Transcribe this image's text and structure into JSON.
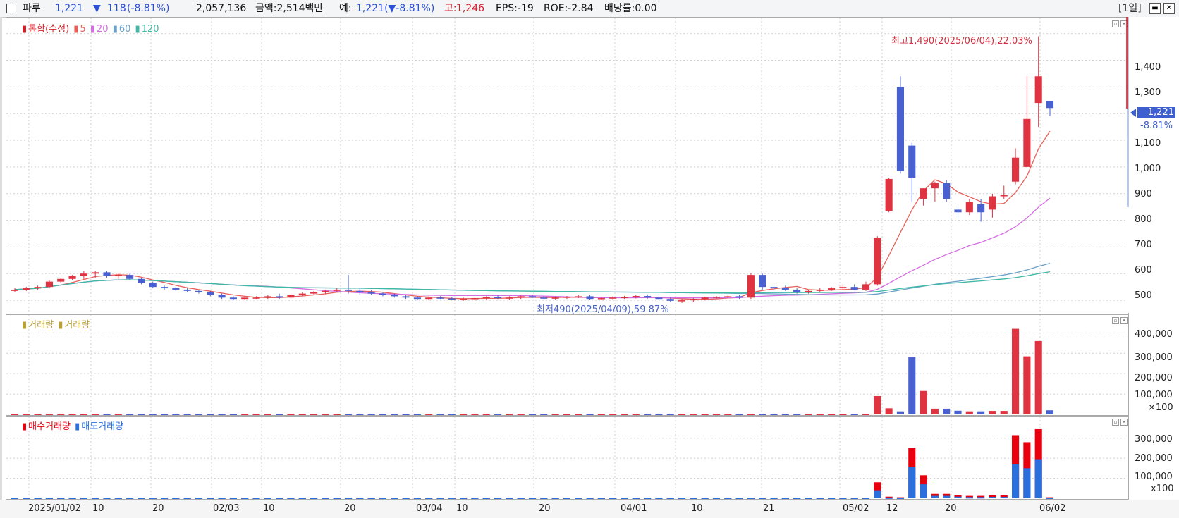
{
  "header": {
    "stock_name": "파루",
    "price": "1,221",
    "change_arrow": "▼",
    "change": "118",
    "change_pct": "(-8.81%)",
    "volume": "2,057,136",
    "amount": "금액:2,514백만",
    "expected_label": "예:",
    "expected_value": "1,221(▼-8.81%)",
    "high_label": "고:",
    "high_value": "1,246",
    "eps": "EPS:-19",
    "roe": "ROE:-2.84",
    "dividend": "배당률:0.00",
    "period": "[1일]",
    "colors": {
      "down": "#2b50d8",
      "up": "#d11f2a"
    }
  },
  "price_panel": {
    "legend": {
      "main": "통합(수정)",
      "ma5": "5",
      "ma20": "20",
      "ma60": "60",
      "ma120": "120"
    },
    "high_annotation": "최고1,490(2025/06/04),22.03%",
    "low_annotation": "최저490(2025/04/09),59.87%",
    "y_labels": [
      "1,400",
      "1,300",
      "1,200",
      "1,100",
      "1,000",
      "900",
      "800",
      "700",
      "600",
      "500"
    ],
    "current_price": "1,221",
    "current_pct": "-8.81%",
    "colors": {
      "up": "#e03341",
      "down": "#4860d0",
      "ma5": "#e8605a",
      "ma20": "#d36de0",
      "ma60": "#6aa0c8",
      "ma120": "#3fb8a5"
    }
  },
  "volume_panel": {
    "legend": [
      "거래량",
      "거래량"
    ],
    "y_labels": [
      "400,000",
      "300,000",
      "200,000",
      "100,000"
    ],
    "unit": "×100"
  },
  "buysell_panel": {
    "legend": {
      "buy": "매수거래량",
      "sell": "매도거래량"
    },
    "y_labels": [
      "300,000",
      "200,000",
      "100,000"
    ],
    "unit": "x100",
    "colors": {
      "buy": "#e8000f",
      "sell": "#2a6fdc"
    }
  },
  "x_axis": {
    "labels": [
      "2025/01/02",
      "10",
      "20",
      "02/03",
      "10",
      "20",
      "03/04",
      "10",
      "20",
      "04/01",
      "10",
      "21",
      "05/02",
      "12",
      "20",
      "06/02"
    ]
  },
  "chart_data": [
    {
      "type": "candlestick",
      "title": "통합(수정)",
      "y_unit": "KRW",
      "ylim": [
        450,
        1560
      ],
      "ma_periods": [
        5,
        20,
        60,
        120
      ],
      "candles_ohlc": [
        [
          535,
          545,
          530,
          540
        ],
        [
          540,
          550,
          535,
          545
        ],
        [
          545,
          555,
          540,
          550
        ],
        [
          550,
          575,
          545,
          570
        ],
        [
          570,
          585,
          565,
          580
        ],
        [
          580,
          595,
          575,
          590
        ],
        [
          590,
          610,
          580,
          600
        ],
        [
          600,
          610,
          585,
          605
        ],
        [
          605,
          610,
          585,
          590
        ],
        [
          590,
          600,
          580,
          595
        ],
        [
          595,
          600,
          575,
          580
        ],
        [
          580,
          585,
          560,
          565
        ],
        [
          565,
          570,
          545,
          550
        ],
        [
          550,
          555,
          540,
          545
        ],
        [
          545,
          550,
          535,
          540
        ],
        [
          540,
          545,
          530,
          535
        ],
        [
          535,
          540,
          525,
          530
        ],
        [
          530,
          535,
          515,
          520
        ],
        [
          520,
          525,
          505,
          510
        ],
        [
          510,
          515,
          500,
          505
        ],
        [
          505,
          515,
          500,
          510
        ],
        [
          510,
          515,
          505,
          510
        ],
        [
          510,
          520,
          505,
          515
        ],
        [
          515,
          525,
          505,
          510
        ],
        [
          510,
          525,
          505,
          520
        ],
        [
          520,
          530,
          515,
          525
        ],
        [
          525,
          535,
          520,
          530
        ],
        [
          530,
          540,
          525,
          535
        ],
        [
          535,
          545,
          530,
          540
        ],
        [
          540,
          595,
          525,
          535
        ],
        [
          535,
          545,
          520,
          530
        ],
        [
          530,
          540,
          520,
          525
        ],
        [
          525,
          530,
          515,
          520
        ],
        [
          520,
          525,
          510,
          515
        ],
        [
          515,
          520,
          505,
          510
        ],
        [
          510,
          515,
          500,
          505
        ],
        [
          505,
          515,
          500,
          510
        ],
        [
          510,
          515,
          505,
          507
        ],
        [
          507,
          512,
          500,
          503
        ],
        [
          503,
          510,
          498,
          505
        ],
        [
          505,
          512,
          500,
          508
        ],
        [
          508,
          515,
          503,
          512
        ],
        [
          512,
          518,
          505,
          508
        ],
        [
          508,
          515,
          502,
          510
        ],
        [
          510,
          517,
          505,
          515
        ],
        [
          515,
          520,
          508,
          510
        ],
        [
          510,
          515,
          505,
          508
        ],
        [
          508,
          513,
          503,
          510
        ],
        [
          510,
          516,
          505,
          513
        ],
        [
          513,
          520,
          508,
          515
        ],
        [
          515,
          520,
          502,
          505
        ],
        [
          505,
          512,
          500,
          508
        ],
        [
          508,
          515,
          503,
          510
        ],
        [
          510,
          516,
          505,
          512
        ],
        [
          512,
          520,
          507,
          516
        ],
        [
          516,
          522,
          505,
          510
        ],
        [
          510,
          515,
          500,
          505
        ],
        [
          505,
          510,
          495,
          498
        ],
        [
          498,
          505,
          490,
          500
        ],
        [
          500,
          508,
          495,
          505
        ],
        [
          505,
          512,
          500,
          510
        ],
        [
          510,
          516,
          505,
          513
        ],
        [
          513,
          518,
          508,
          515
        ],
        [
          515,
          520,
          505,
          510
        ],
        [
          510,
          600,
          505,
          595
        ],
        [
          595,
          600,
          540,
          550
        ],
        [
          550,
          560,
          540,
          545
        ],
        [
          545,
          555,
          535,
          540
        ],
        [
          540,
          545,
          525,
          530
        ],
        [
          530,
          540,
          525,
          535
        ],
        [
          535,
          545,
          530,
          540
        ],
        [
          540,
          550,
          535,
          545
        ],
        [
          545,
          560,
          540,
          550
        ],
        [
          550,
          560,
          538,
          540
        ],
        [
          540,
          570,
          535,
          560
        ],
        [
          560,
          740,
          555,
          735
        ],
        [
          835,
          960,
          830,
          955
        ],
        [
          1300,
          1340,
          975,
          985
        ],
        [
          1080,
          1090,
          870,
          960
        ],
        [
          880,
          920,
          855,
          920
        ],
        [
          920,
          945,
          870,
          940
        ],
        [
          940,
          950,
          870,
          880
        ],
        [
          840,
          850,
          805,
          830
        ],
        [
          830,
          880,
          820,
          870
        ],
        [
          860,
          880,
          795,
          830
        ],
        [
          840,
          900,
          810,
          890
        ],
        [
          890,
          930,
          880,
          895
        ],
        [
          945,
          1070,
          935,
          1035
        ],
        [
          1000,
          1340,
          1000,
          1180
        ],
        [
          1240,
          1490,
          1150,
          1340
        ],
        [
          1246,
          1246,
          1190,
          1221
        ]
      ]
    },
    {
      "type": "bar",
      "title": "거래량",
      "y_unit": "×100",
      "ylim": [
        0,
        460000
      ],
      "values": [
        2000,
        2000,
        2000,
        2000,
        2000,
        2000,
        2000,
        2000,
        2000,
        2000,
        2000,
        2000,
        2000,
        2000,
        2000,
        2000,
        2000,
        2000,
        2000,
        2000,
        2000,
        2000,
        2000,
        2000,
        2000,
        2000,
        2000,
        2000,
        2000,
        2000,
        2000,
        2000,
        2000,
        2000,
        2000,
        2000,
        2000,
        2000,
        2000,
        2000,
        2000,
        2000,
        2000,
        2000,
        2000,
        2000,
        2000,
        2000,
        2000,
        2000,
        2000,
        2000,
        2000,
        2000,
        2000,
        2000,
        2000,
        2000,
        2000,
        2000,
        2000,
        2000,
        2000,
        2000,
        2000,
        2000,
        2000,
        2000,
        2000,
        2000,
        2000,
        2000,
        2000,
        2000,
        2000,
        90000,
        30000,
        15000,
        280000,
        115000,
        28000,
        28000,
        18000,
        15000,
        15000,
        17000,
        17000,
        420000,
        285000,
        360000,
        20000
      ]
    },
    {
      "type": "stacked_bar",
      "title": "매수거래량 / 매도거래량",
      "y_unit": "x100",
      "ylim": [
        0,
        380000
      ],
      "series": [
        {
          "name": "매수거래량",
          "values": [
            3000,
            3000,
            3000,
            3000,
            3000,
            3000,
            3000,
            3000,
            3000,
            3000,
            3000,
            3000,
            3000,
            3000,
            3000,
            3000,
            3000,
            3000,
            3000,
            3000,
            3000,
            3000,
            3000,
            3000,
            3000,
            3000,
            3000,
            3000,
            3000,
            3000,
            3000,
            3000,
            3000,
            3000,
            3000,
            3000,
            3000,
            3000,
            3000,
            3000,
            3000,
            3000,
            3000,
            3000,
            3000,
            3000,
            3000,
            3000,
            3000,
            3000,
            3000,
            3000,
            3000,
            3000,
            3000,
            3000,
            3000,
            3000,
            3000,
            3000,
            3000,
            3000,
            3000,
            3000,
            3000,
            3000,
            3000,
            3000,
            3000,
            3000,
            3000,
            3000,
            3000,
            3000,
            3000,
            80000,
            8000,
            5000,
            250000,
            115000,
            22000,
            22000,
            15000,
            12000,
            12000,
            15000,
            15000,
            315000,
            280000,
            345000,
            5000
          ]
        },
        {
          "name": "매도거래량",
          "values": [
            2000,
            2000,
            2000,
            2000,
            2000,
            2000,
            2000,
            2000,
            2000,
            2000,
            2000,
            2000,
            2000,
            2000,
            2000,
            2000,
            2000,
            2000,
            2000,
            2000,
            2000,
            2000,
            2000,
            2000,
            2000,
            2000,
            2000,
            2000,
            2000,
            2000,
            2000,
            2000,
            2000,
            2000,
            2000,
            2000,
            2000,
            2000,
            2000,
            2000,
            2000,
            2000,
            2000,
            2000,
            2000,
            2000,
            2000,
            2000,
            2000,
            2000,
            2000,
            2000,
            2000,
            2000,
            2000,
            2000,
            2000,
            2000,
            2000,
            2000,
            2000,
            2000,
            2000,
            2000,
            2000,
            2000,
            2000,
            2000,
            2000,
            2000,
            2000,
            2000,
            2000,
            2000,
            2000,
            40000,
            4000,
            2000,
            155000,
            70000,
            12000,
            12000,
            8000,
            6000,
            6000,
            7000,
            7000,
            170000,
            150000,
            195000,
            3000
          ]
        }
      ]
    }
  ]
}
